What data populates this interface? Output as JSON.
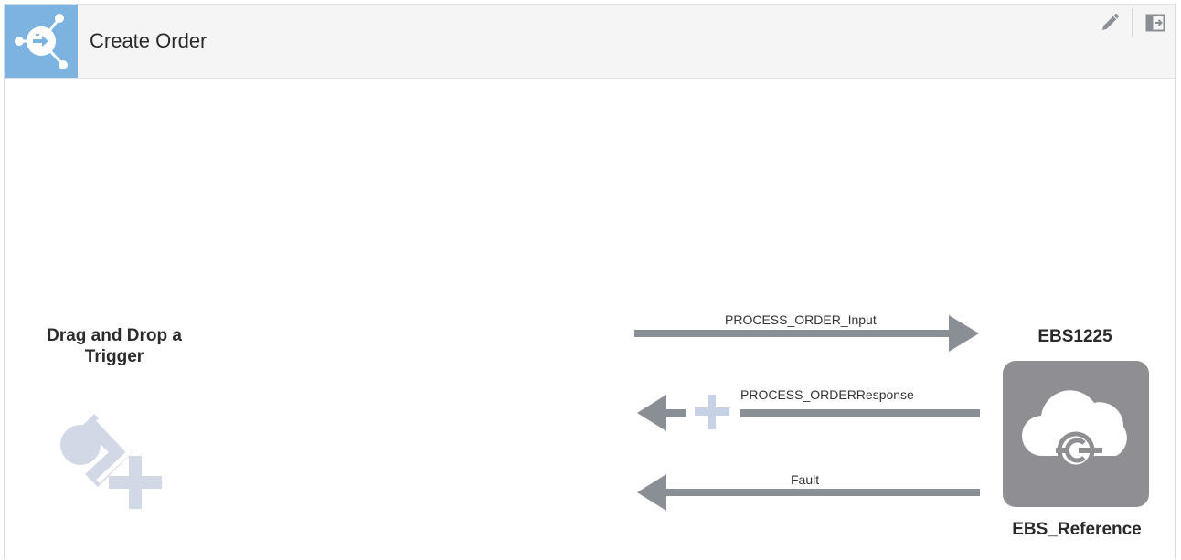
{
  "header": {
    "title": "Create Order",
    "logo_icon": "integration-icon",
    "edit_icon": "pencil-icon",
    "panel_icon": "panel-toggle-icon"
  },
  "trigger": {
    "label": "Drag and Drop a Trigger",
    "icon": "add-trigger-icon"
  },
  "flows": {
    "request_label": "PROCESS_ORDER_Input",
    "response_label": "PROCESS_ORDERResponse",
    "fault_label": "Fault",
    "add_icon": "plus-icon"
  },
  "invoke": {
    "name": "EBS1225",
    "reference": "EBS_Reference",
    "icon": "cloud-adapter-icon"
  },
  "colors": {
    "header_bg": "#f5f5f5",
    "logo_bg": "#7db3e0",
    "arrow": "#8a8f96",
    "tile": "#8e8e93",
    "trigger_icon": "#d3d8e6",
    "plus": "#c8d2e6"
  }
}
